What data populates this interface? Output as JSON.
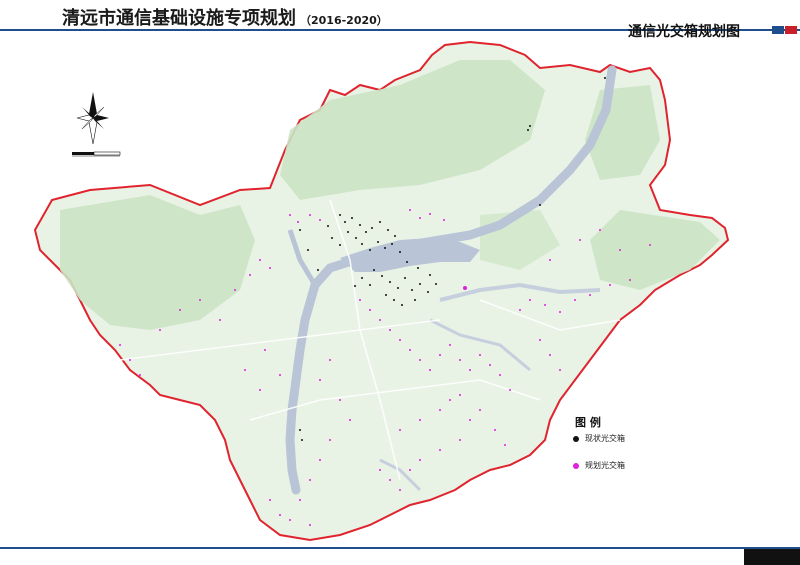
{
  "header": {
    "title": "清远市通信基础设施专项规划",
    "years": "（2016-2020）",
    "map_name": "通信光交箱规划图"
  },
  "legend": {
    "title": "图 例",
    "items": [
      {
        "label": "现状光交箱",
        "color": "#111111"
      },
      {
        "label": "规划光交箱",
        "color": "#e020e0"
      }
    ]
  },
  "colors": {
    "boundary": "#e0242e",
    "water": "#b9c4d6",
    "land": "#e8f3e6",
    "forest": "#c9e2c2",
    "accent_blue": "#1f4e8c",
    "accent_red": "#c8202a"
  }
}
